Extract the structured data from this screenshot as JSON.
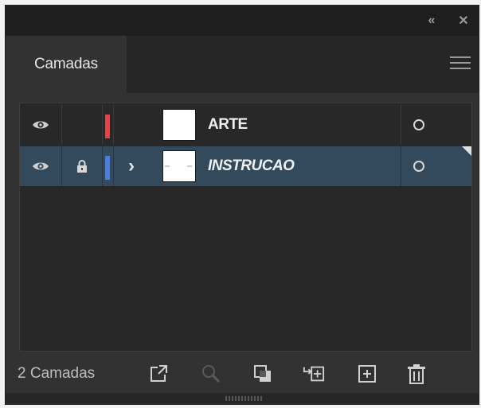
{
  "panel": {
    "tab_label": "Camadas",
    "collapse_glyph": "«",
    "close_glyph": "✕"
  },
  "layers": [
    {
      "name": "ARTE",
      "visible": true,
      "locked": false,
      "expandable": false,
      "color": "#e0434a",
      "selected": false,
      "italic": false
    },
    {
      "name": "INSTRUCAO",
      "visible": true,
      "locked": true,
      "expandable": true,
      "expand_glyph": "›",
      "color": "#4a7ed8",
      "selected": true,
      "italic": true
    }
  ],
  "footer": {
    "layer_count": "2 Camadas",
    "buttons": [
      "export-icon",
      "search-icon",
      "clipping-mask-icon",
      "new-sublayer-icon",
      "new-layer-icon",
      "trash-icon"
    ]
  },
  "colors": {
    "panel_bg": "#323232",
    "titlebar_bg": "#1f1f1f",
    "selected_row": "#334a5c"
  }
}
